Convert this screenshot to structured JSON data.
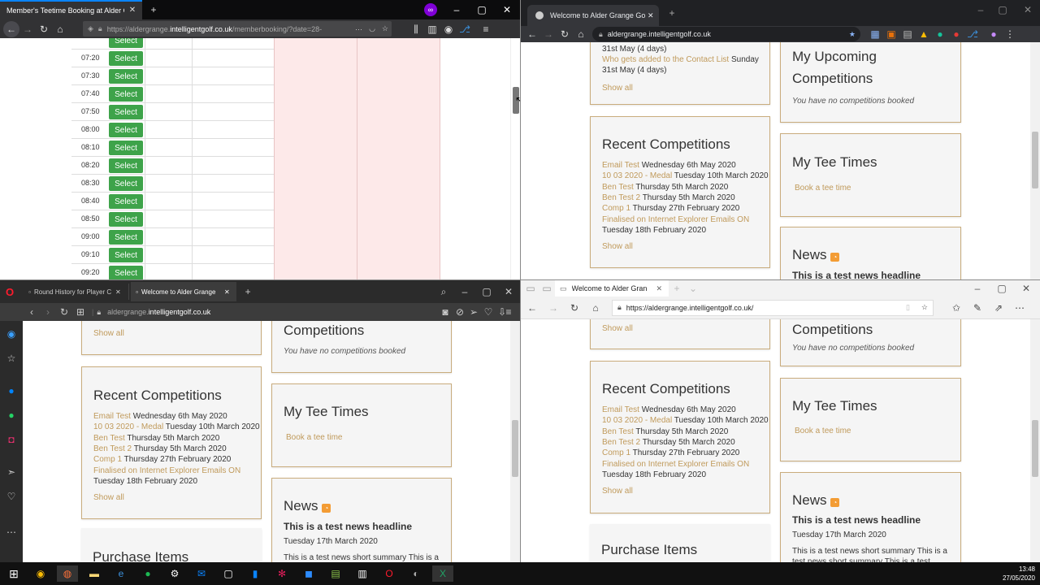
{
  "firefox": {
    "tab_title": "Member's Teetime Booking at Alder G",
    "url_prefix": "https://aldergrange.",
    "url_domain": "intelligentgolf.co.uk",
    "url_rest": "/memberbooking/?date=28-",
    "select_label": "Select",
    "times": [
      "07:20",
      "07:30",
      "07:40",
      "07:50",
      "08:00",
      "08:10",
      "08:20",
      "08:30",
      "08:40",
      "08:50",
      "09:00",
      "09:10",
      "09:20"
    ]
  },
  "chrome": {
    "tab_title": "Welcome to Alder Grange Golf C",
    "url": "aldergrange.intelligentgolf.co.uk"
  },
  "opera": {
    "tab1_title": "Round History for Player C",
    "tab2_title": "Welcome to Alder Grange",
    "url_prefix": "aldergrange.",
    "url_domain": "intelligentgolf.co.uk"
  },
  "edge": {
    "tab_title": "Welcome to Alder Gran",
    "url": "https://aldergrange.intelligentgolf.co.uk/"
  },
  "site": {
    "show_all": "Show all",
    "upcoming_title_1": "My Upcoming",
    "upcoming_title_2": "Competitions",
    "upcoming_title_short": "Competitions",
    "no_comps": "You have no competitions booked",
    "recent_title": "Recent Competitions",
    "recent": [
      {
        "name": "Email Test",
        "date": "Wednesday 6th May 2020"
      },
      {
        "name": "10 03 2020 - Medal",
        "date": "Tuesday 10th March 2020"
      },
      {
        "name": "Ben Test",
        "date": "Thursday 5th March 2020"
      },
      {
        "name": "Ben Test 2",
        "date": "Thursday 5th March 2020"
      },
      {
        "name": "Comp 1",
        "date": "Thursday 27th February 2020"
      },
      {
        "name": "Finalised on Internet Explorer Emails ON",
        "date": ""
      }
    ],
    "recent_last_date": "Tuesday 18th February 2020",
    "tee_title": "My Tee Times",
    "book_tee": "Book a tee time",
    "news_title": "News",
    "news_headline": "This is a test news headline",
    "news_date": "Tuesday 17th March 2020",
    "news_summary": "This is a test news short summary This is a test news short summary This is a test news",
    "purchase_title": "Purchase Items",
    "upcoming_snip1": "31st May (4 days)",
    "upcoming_snip2_name": "Who gets added to the Contact List",
    "upcoming_snip2_date": "Sunday",
    "upcoming_snip3": "31st May (4 days)"
  },
  "taskbar": {
    "time": "13:48",
    "date": "27/05/2020"
  },
  "colors": {
    "gold": "#c09a5b",
    "green": "#3ea34a",
    "pink": "#fde9e9"
  }
}
